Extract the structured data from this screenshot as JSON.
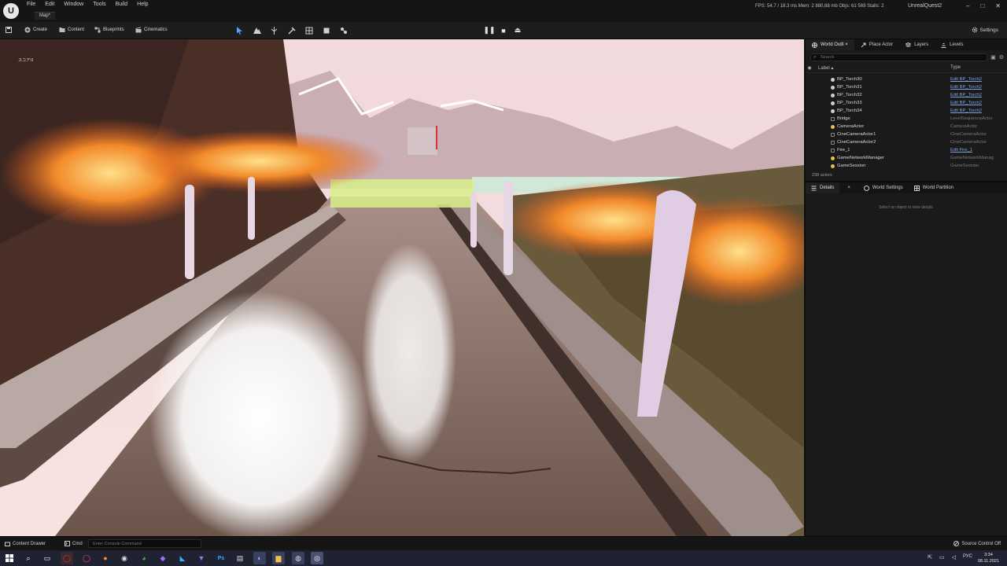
{
  "app": {
    "logo": "U",
    "menus": [
      "File",
      "Edit",
      "Window",
      "Tools",
      "Build",
      "Help"
    ],
    "map_tab": "Map*",
    "stats": "FPS: 54.7  /  18.3 ms   Mem: 2 880,68 mb   Objs: 61 569   Stalls: 2",
    "project": "UnrealQuest2",
    "window_buttons": [
      "–",
      "□",
      "✕"
    ]
  },
  "toolbar": {
    "save_icon": "save-icon",
    "create": "Create",
    "content": "Content",
    "blueprints": "Blueprints",
    "cinematics": "Cinematics",
    "mode_icons": [
      "select-icon",
      "landscape-icon",
      "foliage-icon",
      "paint-icon",
      "mesh-icon",
      "fracture-icon",
      "brush-icon"
    ],
    "play_pause": "❚❚",
    "play_stop": "■",
    "play_eject": "⏏",
    "settings": "Settings"
  },
  "viewport": {
    "overlay_label": "スコア:0"
  },
  "outliner": {
    "tabs": [
      "World Outli ×",
      "Place Actor",
      "Layers",
      "Levels"
    ],
    "search_placeholder": "Search",
    "header_label": "Label ▴",
    "header_type": "Type",
    "rows": [
      {
        "name": "BP_Torch30",
        "type": "Edit BP_Torch2",
        "link": true,
        "dot": "grey"
      },
      {
        "name": "BP_Torch31",
        "type": "Edit BP_Torch2",
        "link": true,
        "dot": "grey"
      },
      {
        "name": "BP_Torch32",
        "type": "Edit BP_Torch2",
        "link": true,
        "dot": "grey"
      },
      {
        "name": "BP_Torch33",
        "type": "Edit BP_Torch2",
        "link": true,
        "dot": "grey"
      },
      {
        "name": "BP_Torch34",
        "type": "Edit BP_Torch2",
        "link": true,
        "dot": "grey"
      },
      {
        "name": "Bridge",
        "type": "LevelSequenceActor",
        "link": false,
        "dot": "none"
      },
      {
        "name": "CameraActor",
        "type": "CameraActor",
        "link": false,
        "dot": "yellow"
      },
      {
        "name": "CineCameraActor1",
        "type": "CineCameraActor",
        "link": false,
        "dot": "none"
      },
      {
        "name": "CineCameraActor2",
        "type": "CineCameraActor",
        "link": false,
        "dot": "none"
      },
      {
        "name": "Fire_1",
        "type": "Edit Fire_1",
        "link": true,
        "dot": "none"
      },
      {
        "name": "GameNetworkManager",
        "type": "GameNetworkManag",
        "link": false,
        "dot": "yellow"
      },
      {
        "name": "GameSession",
        "type": "GameSession",
        "link": false,
        "dot": "yellow"
      }
    ],
    "actor_count": "238 actors"
  },
  "details": {
    "tabs": [
      "Details",
      "×",
      "World Settings",
      "World Partition"
    ],
    "empty_text": "Select an object to view details."
  },
  "statusbar": {
    "content_drawer": "Content Drawer",
    "cmd": "Cmd",
    "console_placeholder": "Enter Console Command",
    "source_control": "Source Control Off"
  },
  "taskbar": {
    "lang": "РУС",
    "time": "3:34",
    "date": "08.11.2021"
  }
}
